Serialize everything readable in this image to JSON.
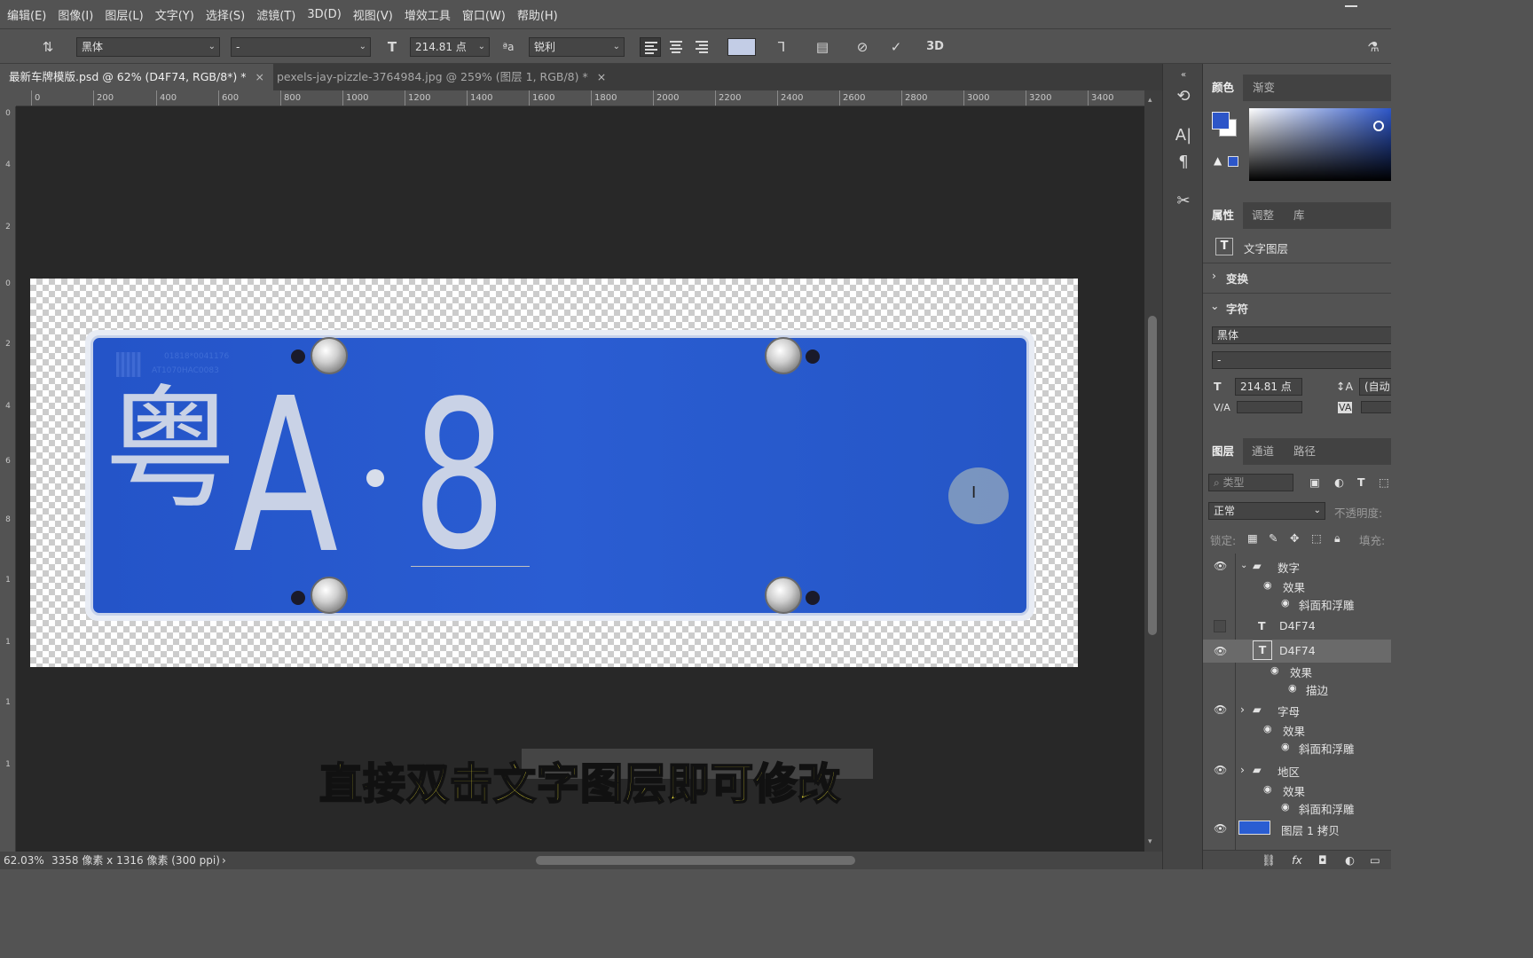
{
  "menu": [
    "编辑(E)",
    "图像(I)",
    "图层(L)",
    "文字(Y)",
    "选择(S)",
    "滤镜(T)",
    "3D(D)",
    "视图(V)",
    "增效工具",
    "窗口(W)",
    "帮助(H)"
  ],
  "options": {
    "font_family": "黑体",
    "font_style": "-",
    "font_size": "214.81 点",
    "aa_label": "ªa",
    "antialias": "锐利",
    "threed": "3D",
    "text_color": "#c3cde6"
  },
  "tabs": [
    {
      "label": "最新车牌模版.psd @ 62% (D4F74, RGB/8*) *",
      "close": "×"
    },
    {
      "label": "pexels-jay-pizzle-3764984.jpg @ 259% (图层 1, RGB/8) *",
      "close": "×"
    }
  ],
  "ruler_h": [
    "0",
    "200",
    "400",
    "600",
    "800",
    "1000",
    "1200",
    "1400",
    "1600",
    "1800",
    "2000",
    "2200",
    "2400",
    "2600",
    "2800",
    "3000",
    "3200",
    "3400"
  ],
  "ruler_v": [
    "0",
    "4",
    "2",
    "0",
    "2",
    "4",
    "6",
    "8",
    "1",
    "1",
    "1",
    "1"
  ],
  "plate": {
    "province": "粤",
    "letter": "A",
    "digit": "8",
    "small_line1": "01818*0041176",
    "small_line2": "AT1070HAC0083"
  },
  "subtitle": "直接双击文字图层即可修改",
  "status": {
    "zoom": "62.03%",
    "info": "3358 像素 x 1316 像素 (300 ppi)"
  },
  "color_panel": {
    "tabs": [
      "颜色",
      "渐变"
    ],
    "fg_color": "#2d56c8",
    "bg_color": "#ffffff"
  },
  "properties": {
    "tabs": [
      "属性",
      "调整",
      "库"
    ],
    "layer_kind": "文字图层",
    "transform": "变换",
    "character": "字符",
    "font_family": "黑体",
    "font_style": "-",
    "size": "214.81 点",
    "leading": "(自动",
    "kerning_label": "V/A",
    "tracking_label": "VA"
  },
  "layers_panel": {
    "tabs": [
      "图层",
      "通道",
      "路径"
    ],
    "search_placeholder": "类型",
    "blend_mode": "正常",
    "opacity_label": "不透明度:",
    "lock_label": "锁定:",
    "fill_label": "填充:",
    "items": [
      {
        "name": "数字",
        "type": "group",
        "visible": true,
        "expanded": true
      },
      {
        "name": "效果",
        "type": "effects",
        "visible": true
      },
      {
        "name": "斜面和浮雕",
        "type": "effect",
        "visible": true
      },
      {
        "name": "D4F74",
        "type": "text",
        "visible": false
      },
      {
        "name": "D4F74",
        "type": "text",
        "visible": true,
        "selected": true
      },
      {
        "name": "效果",
        "type": "effects",
        "visible": true
      },
      {
        "name": "描边",
        "type": "effect",
        "visible": true
      },
      {
        "name": "字母",
        "type": "group",
        "visible": true,
        "expanded": false
      },
      {
        "name": "效果",
        "type": "effects",
        "visible": true
      },
      {
        "name": "斜面和浮雕",
        "type": "effect",
        "visible": true
      },
      {
        "name": "地区",
        "type": "group",
        "visible": true,
        "expanded": false
      },
      {
        "name": "效果",
        "type": "effects",
        "visible": true
      },
      {
        "name": "斜面和浮雕",
        "type": "effect",
        "visible": true
      },
      {
        "name": "图层 1 拷贝",
        "type": "pixel",
        "visible": true
      }
    ]
  }
}
